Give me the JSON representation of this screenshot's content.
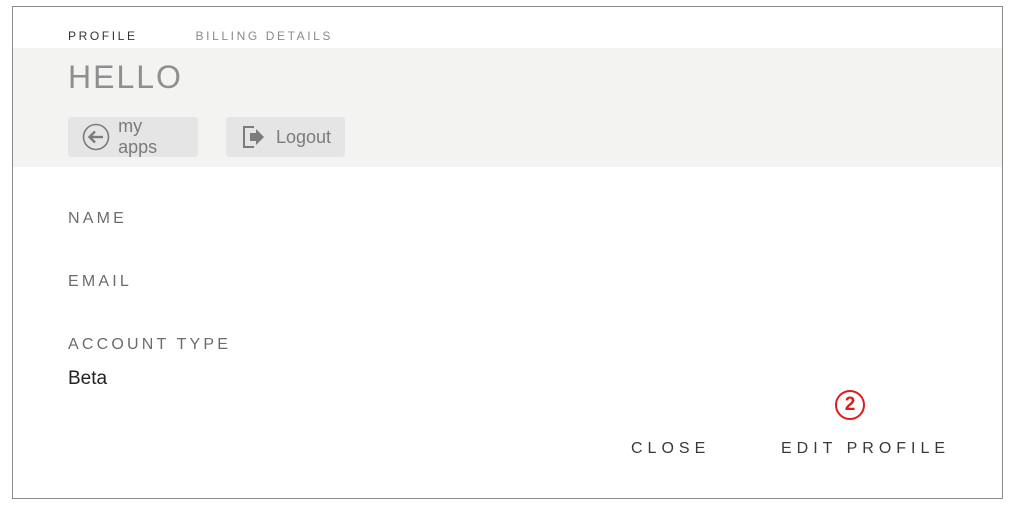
{
  "tabs": {
    "profile": "PROFILE",
    "billing": "BILLING DETAILS"
  },
  "header": {
    "greeting": "HELLO",
    "my_apps_label": "my apps",
    "logout_label": "Logout",
    "my_apps_icon": "arrow-left-circle-icon",
    "logout_icon": "logout-icon"
  },
  "fields": {
    "name_label": "NAME",
    "email_label": "EMAIL",
    "account_type_label": "ACCOUNT TYPE",
    "account_type_value": "Beta"
  },
  "annotation": {
    "badge": "2",
    "color": "#dd1c1c"
  },
  "actions": {
    "close_label": "CLOSE",
    "edit_profile_label": "EDIT PROFILE"
  }
}
